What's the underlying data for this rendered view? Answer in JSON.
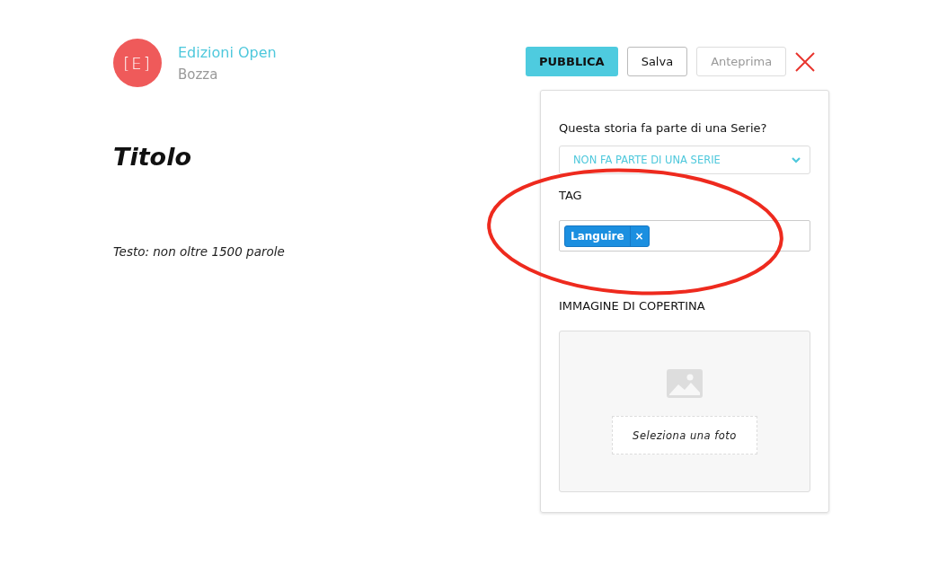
{
  "brand": {
    "name": "Edizioni Open",
    "status": "Bozza",
    "logo_text": "[E]"
  },
  "editor": {
    "title_placeholder": "Titolo",
    "body_placeholder": "Testo: non oltre 1500 parole"
  },
  "actions": [
    {
      "label": "PUBBLICA",
      "kind": "primary",
      "disabled": false
    },
    {
      "label": "Salva",
      "kind": "secondary",
      "disabled": false
    },
    {
      "label": "Anteprima",
      "kind": "secondary",
      "disabled": true
    }
  ],
  "panel": {
    "series_label": "Questa storia fa parte di una Serie?",
    "series_value": "NON FA PARTE DI UNA SERIE",
    "tag_label": "TAG",
    "tags": [
      {
        "label": "Languire",
        "remove": "×"
      }
    ],
    "cover_label": "IMMAGINE DI COPERTINA",
    "cover_button": "Seleziona una foto"
  }
}
